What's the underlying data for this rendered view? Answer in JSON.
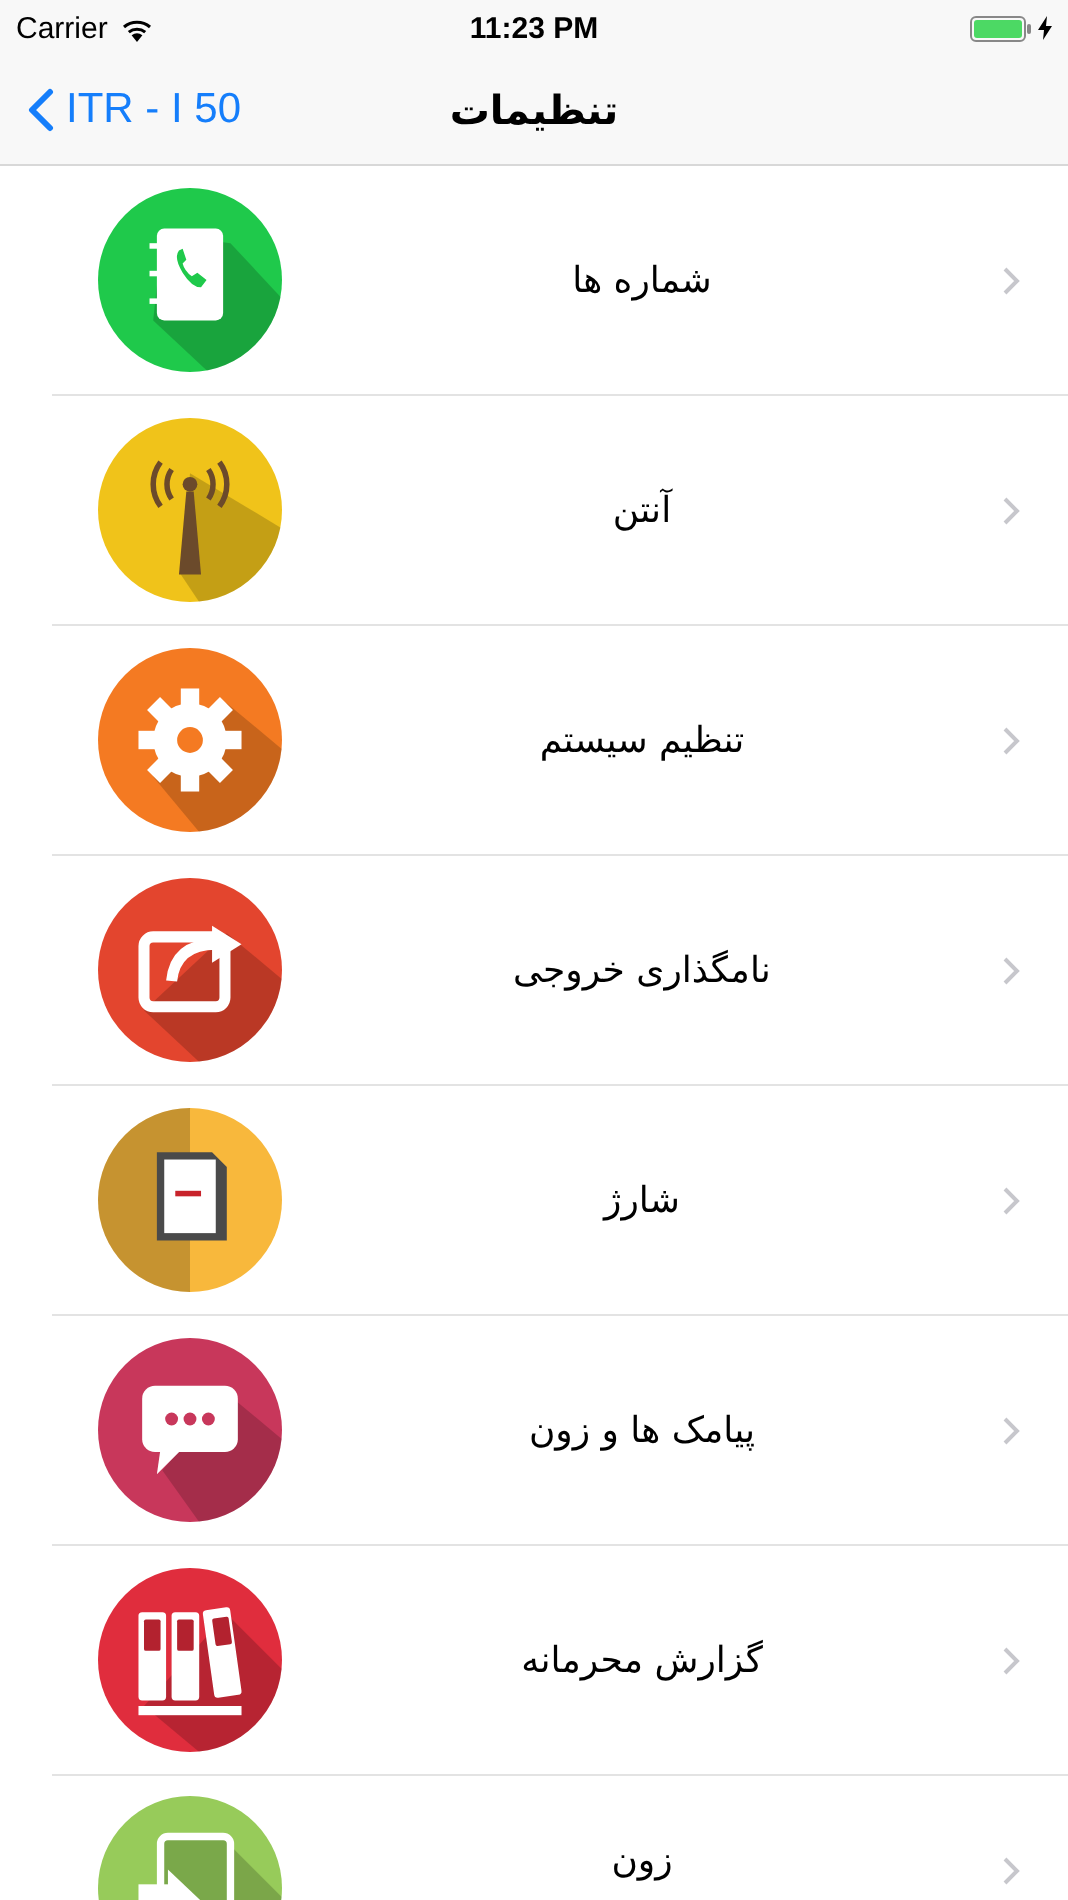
{
  "status_bar": {
    "carrier": "Carrier",
    "time": "11:23 PM"
  },
  "nav_bar": {
    "back": "ITR - I 50",
    "title": "تنظیمات"
  },
  "items": [
    {
      "label": "شماره ها",
      "color": "#1fc94b"
    },
    {
      "label": "آنتن",
      "color": "#f0c31a"
    },
    {
      "label": "تنظیم سیستم",
      "color": "#f47a22"
    },
    {
      "label": "نامگذاری خروجی",
      "color": "#e3452e"
    },
    {
      "label": "شارژ",
      "color": "#f8b83c"
    },
    {
      "label": "پیامک ها و زون",
      "color": "#c8375b"
    },
    {
      "label": "گزارش محرمانه",
      "color": "#e02d3d"
    },
    {
      "label": "زون",
      "color": "#97cb5a"
    }
  ]
}
